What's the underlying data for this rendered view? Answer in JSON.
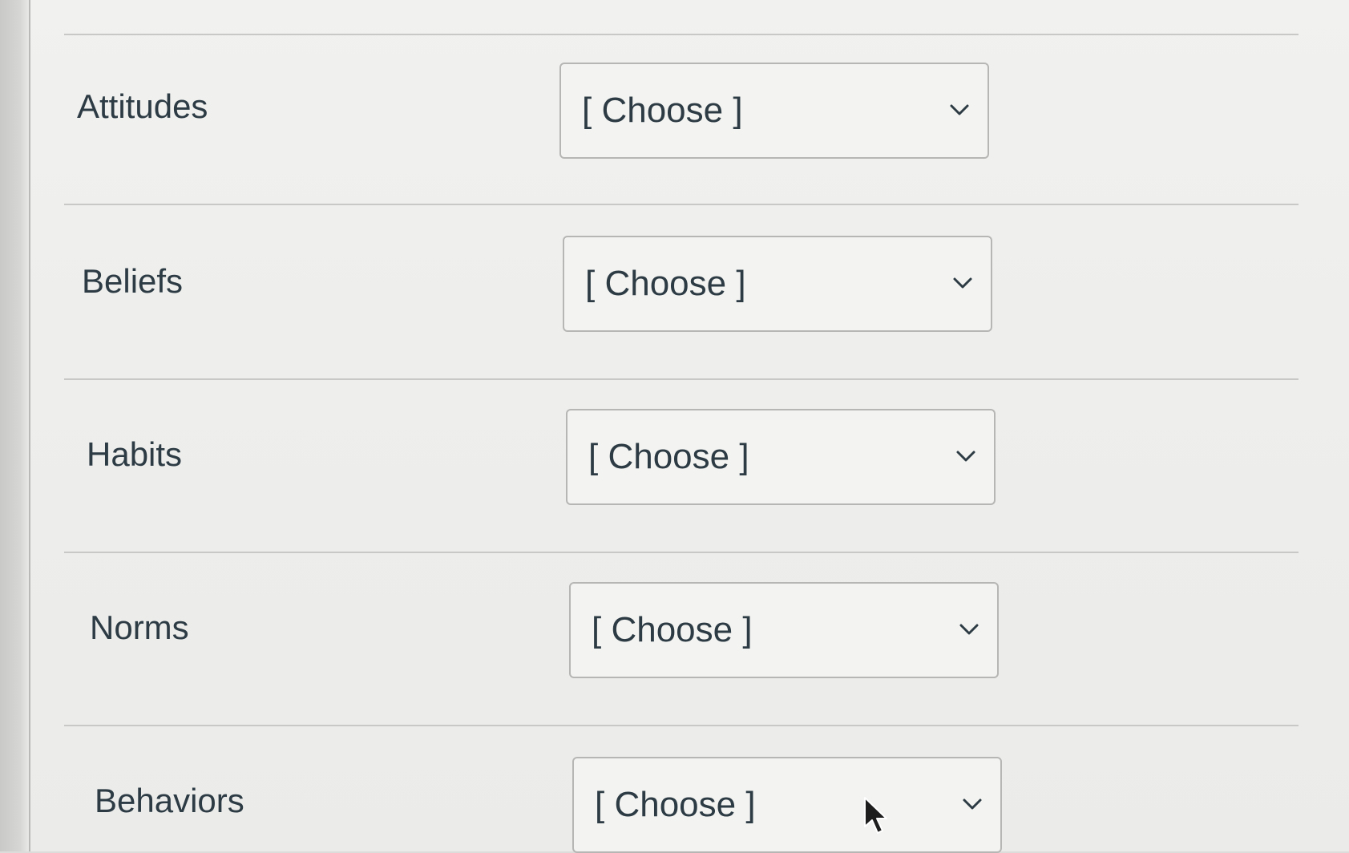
{
  "quiz": {
    "rows": [
      {
        "label": "Attitudes",
        "selected": "[ Choose ]"
      },
      {
        "label": "Beliefs",
        "selected": "[ Choose ]"
      },
      {
        "label": "Habits",
        "selected": "[ Choose ]"
      },
      {
        "label": "Norms",
        "selected": "[ Choose ]"
      },
      {
        "label": "Behaviors",
        "selected": "[ Choose ]"
      }
    ]
  },
  "icons": {
    "dropdown": "chevron-down-icon",
    "pointer": "mouse-cursor-icon"
  },
  "colors": {
    "text": "#2d3b45",
    "border": "#b6b6b4",
    "background": "#f1f1ef"
  }
}
